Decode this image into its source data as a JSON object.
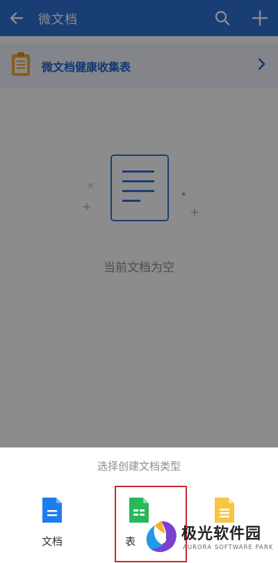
{
  "header": {
    "title": "微文档",
    "bg_color": "#2f6fd6"
  },
  "banner": {
    "label": "微文档健康收集表",
    "icon": "clipboard-icon"
  },
  "empty_state": {
    "message": "当前文档为空"
  },
  "sheet": {
    "title": "选择创建文档类型",
    "options": [
      {
        "label": "文档",
        "icon": "doc-file-icon",
        "color": "#1f7cf0"
      },
      {
        "label": "表",
        "icon": "sheet-file-icon",
        "color": "#27b85a"
      },
      {
        "label": "",
        "icon": "slide-file-icon",
        "color": "#f6c544"
      }
    ]
  },
  "watermark": {
    "name": "极光软件园",
    "sub": "AURORA SOFTWARE PARK"
  }
}
